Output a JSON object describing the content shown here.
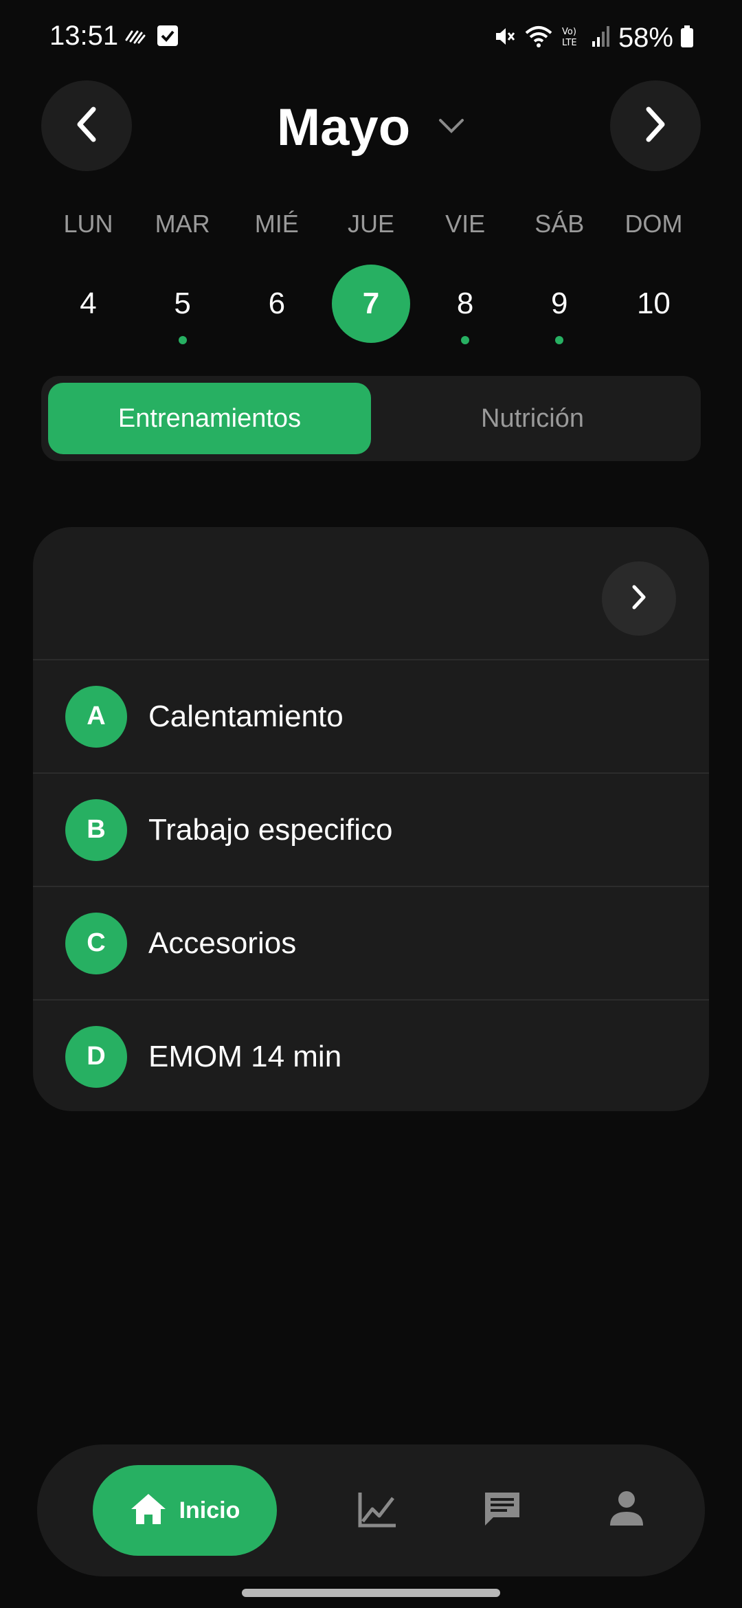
{
  "status_bar": {
    "time": "13:51",
    "battery": "58%",
    "icons": [
      "sound-wave-icon",
      "checkbox-icon",
      "mute-icon",
      "wifi-icon",
      "volte-icon",
      "signal-icon",
      "battery-icon"
    ]
  },
  "header": {
    "month": "Mayo",
    "prev_icon": "chevron-left-icon",
    "next_icon": "chevron-right-icon",
    "dropdown_icon": "chevron-down-icon"
  },
  "week": {
    "weekdays": [
      "LUN",
      "MAR",
      "MIÉ",
      "JUE",
      "VIE",
      "SÁB",
      "DOM"
    ],
    "days": [
      "4",
      "5",
      "6",
      "7",
      "8",
      "9",
      "10"
    ],
    "selected_day": "7",
    "days_with_events": [
      "5",
      "8",
      "9"
    ]
  },
  "tabs": {
    "active": "Entrenamientos",
    "inactive": "Nutrición"
  },
  "workout": {
    "sections": [
      {
        "letter": "A",
        "name": "Calentamiento"
      },
      {
        "letter": "B",
        "name": "Trabajo especifico"
      },
      {
        "letter": "C",
        "name": "Accesorios"
      },
      {
        "letter": "D",
        "name": "EMOM 14 min"
      }
    ]
  },
  "bottom_nav": {
    "home_label": "Inicio",
    "items": [
      "home-icon",
      "chart-icon",
      "chat-icon",
      "profile-icon"
    ]
  },
  "colors": {
    "accent": "#27b062",
    "background": "#0b0b0b",
    "surface": "#1c1c1c"
  }
}
